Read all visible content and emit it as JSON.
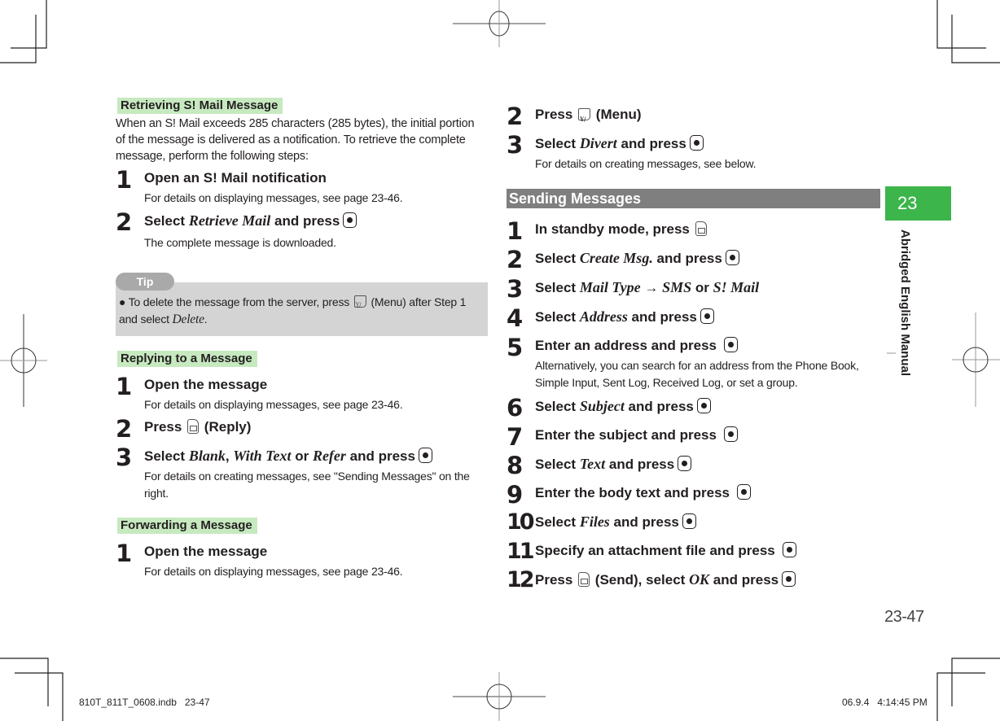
{
  "left": {
    "retrieving": {
      "heading": "Retrieving S! Mail Message",
      "intro": "When an S! Mail exceeds 285 characters (285 bytes), the initial portion of the message is delivered as a notification. To retrieve the complete message, perform the following steps:",
      "steps": [
        {
          "num": "1",
          "title": "Open an S! Mail notification",
          "desc": "For details on displaying messages, see page 23-46."
        },
        {
          "num": "2",
          "title_pre": "Select ",
          "title_em": "Retrieve Mail",
          "title_post": " and press",
          "key": "center-key-icon",
          "desc": "The complete message is downloaded."
        }
      ]
    },
    "tip": {
      "label": "Tip",
      "text_pre": "To delete the message from the server, press",
      "key": "menu-key-icon",
      "text_mid": "(Menu) after Step 1 and select",
      "text_em": "Delete",
      "text_post": "."
    },
    "replying": {
      "heading": "Replying to a Message",
      "steps": [
        {
          "num": "1",
          "title": "Open the message",
          "desc": "For details on displaying messages, see page 23-46."
        },
        {
          "num": "2",
          "title_pre": "Press",
          "key": "mail-key-icon",
          "title_post": "(Reply)"
        },
        {
          "num": "3",
          "title_pre": "Select ",
          "em1": "Blank",
          "sep1": ", ",
          "em2": "With Text",
          "sep2": " or ",
          "em3": "Refer",
          "title_post": " and press",
          "key": "center-key-icon",
          "desc": "For details on creating messages, see \"Sending Messages\" on the right."
        }
      ]
    },
    "forwarding": {
      "heading": "Forwarding a Message",
      "steps": [
        {
          "num": "1",
          "title": "Open the message",
          "desc": "For details on displaying messages, see page 23-46."
        }
      ]
    }
  },
  "right": {
    "forward_cont": [
      {
        "num": "2",
        "title_pre": "Press",
        "key": "menu-key-icon",
        "title_post": "(Menu)"
      },
      {
        "num": "3",
        "title_pre": "Select ",
        "title_em": "Divert",
        "title_post": " and press",
        "key": "center-key-icon",
        "desc": "For details on creating messages, see below."
      }
    ],
    "sending": {
      "heading": "Sending Messages",
      "steps": [
        {
          "num": "1",
          "title_pre": "In standby mode, press",
          "key": "mail-key-icon"
        },
        {
          "num": "2",
          "title_pre": "Select ",
          "title_em": "Create Msg.",
          "title_post": " and press",
          "key": "center-key-icon"
        },
        {
          "num": "3",
          "title_pre": "Select ",
          "title_em": "Mail Type",
          "arrow": " → ",
          "title_em2": "SMS",
          "title_mid": " or ",
          "title_em3": "S! Mail"
        },
        {
          "num": "4",
          "title_pre": "Select ",
          "title_em": "Address",
          "title_post": " and press",
          "key": "center-key-icon"
        },
        {
          "num": "5",
          "title_pre": "Enter an address and press",
          "key": "center-key-icon",
          "desc": "Alternatively, you can search for an address from the Phone Book, Simple Input, Sent Log, Received Log, or set a group."
        },
        {
          "num": "6",
          "title_pre": "Select ",
          "title_em": "Subject",
          "title_post": " and press",
          "key": "center-key-icon"
        },
        {
          "num": "7",
          "title_pre": "Enter the subject and press",
          "key": "center-key-icon"
        },
        {
          "num": "8",
          "title_pre": "Select ",
          "title_em": "Text",
          "title_post": " and press",
          "key": "center-key-icon"
        },
        {
          "num": "9",
          "title_pre": "Enter the body text and press",
          "key": "center-key-icon"
        },
        {
          "num": "10",
          "title_pre": "Select ",
          "title_em": "Files",
          "title_post": " and press",
          "key": "center-key-icon"
        },
        {
          "num": "11",
          "title_pre": "Specify an attachment file and press",
          "key": "center-key-icon"
        },
        {
          "num": "12",
          "title_pre": "Press",
          "key1": "mail-key-icon",
          "title_mid": "(Send), select ",
          "title_em": "OK",
          "title_post": " and press",
          "key": "center-key-icon"
        }
      ]
    }
  },
  "chapter": {
    "number": "23",
    "label": "Abridged English Manual",
    "color": "#3cb54a"
  },
  "page_number": "23-47",
  "footer": {
    "file": "810T_811T_0608.indb   23-47",
    "timestamp": "06.9.4   4:14:45 PM"
  }
}
